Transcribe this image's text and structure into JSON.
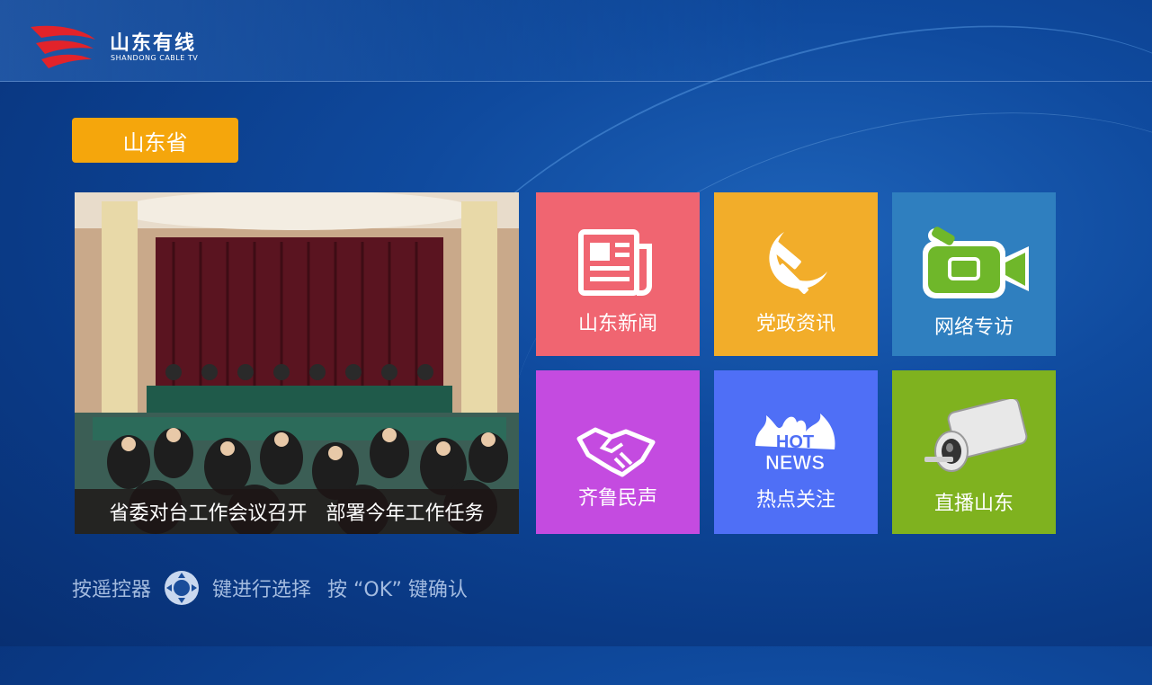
{
  "header": {
    "logo_cn": "山东有线",
    "logo_en": "SHANDONG CABLE TV"
  },
  "region": {
    "label": "山东省"
  },
  "featured": {
    "caption": "省委对台工作会议召开   部署今年工作任务"
  },
  "tiles": [
    {
      "label": "山东新闻",
      "icon": "newspaper-icon",
      "color": "#f06571"
    },
    {
      "label": "党政资讯",
      "icon": "hammer-sickle-icon",
      "color": "#f2ad2a"
    },
    {
      "label": "网络专访",
      "icon": "video-camera-icon",
      "color": "#2f7fbf"
    },
    {
      "label": "齐鲁民声",
      "icon": "handshake-icon",
      "color": "#c44be0"
    },
    {
      "label": "热点关注",
      "icon": "hot-news-icon",
      "color": "#4f6ff6"
    },
    {
      "label": "直播山东",
      "icon": "cctv-camera-icon",
      "color": "#7fb21f"
    }
  ],
  "hint": {
    "part1": "按遥控器",
    "part2": "键进行选择",
    "part3": "按 “OK” 键确认"
  },
  "colors": {
    "region_button": "#f5a60c",
    "background": "#0f4a9e"
  }
}
